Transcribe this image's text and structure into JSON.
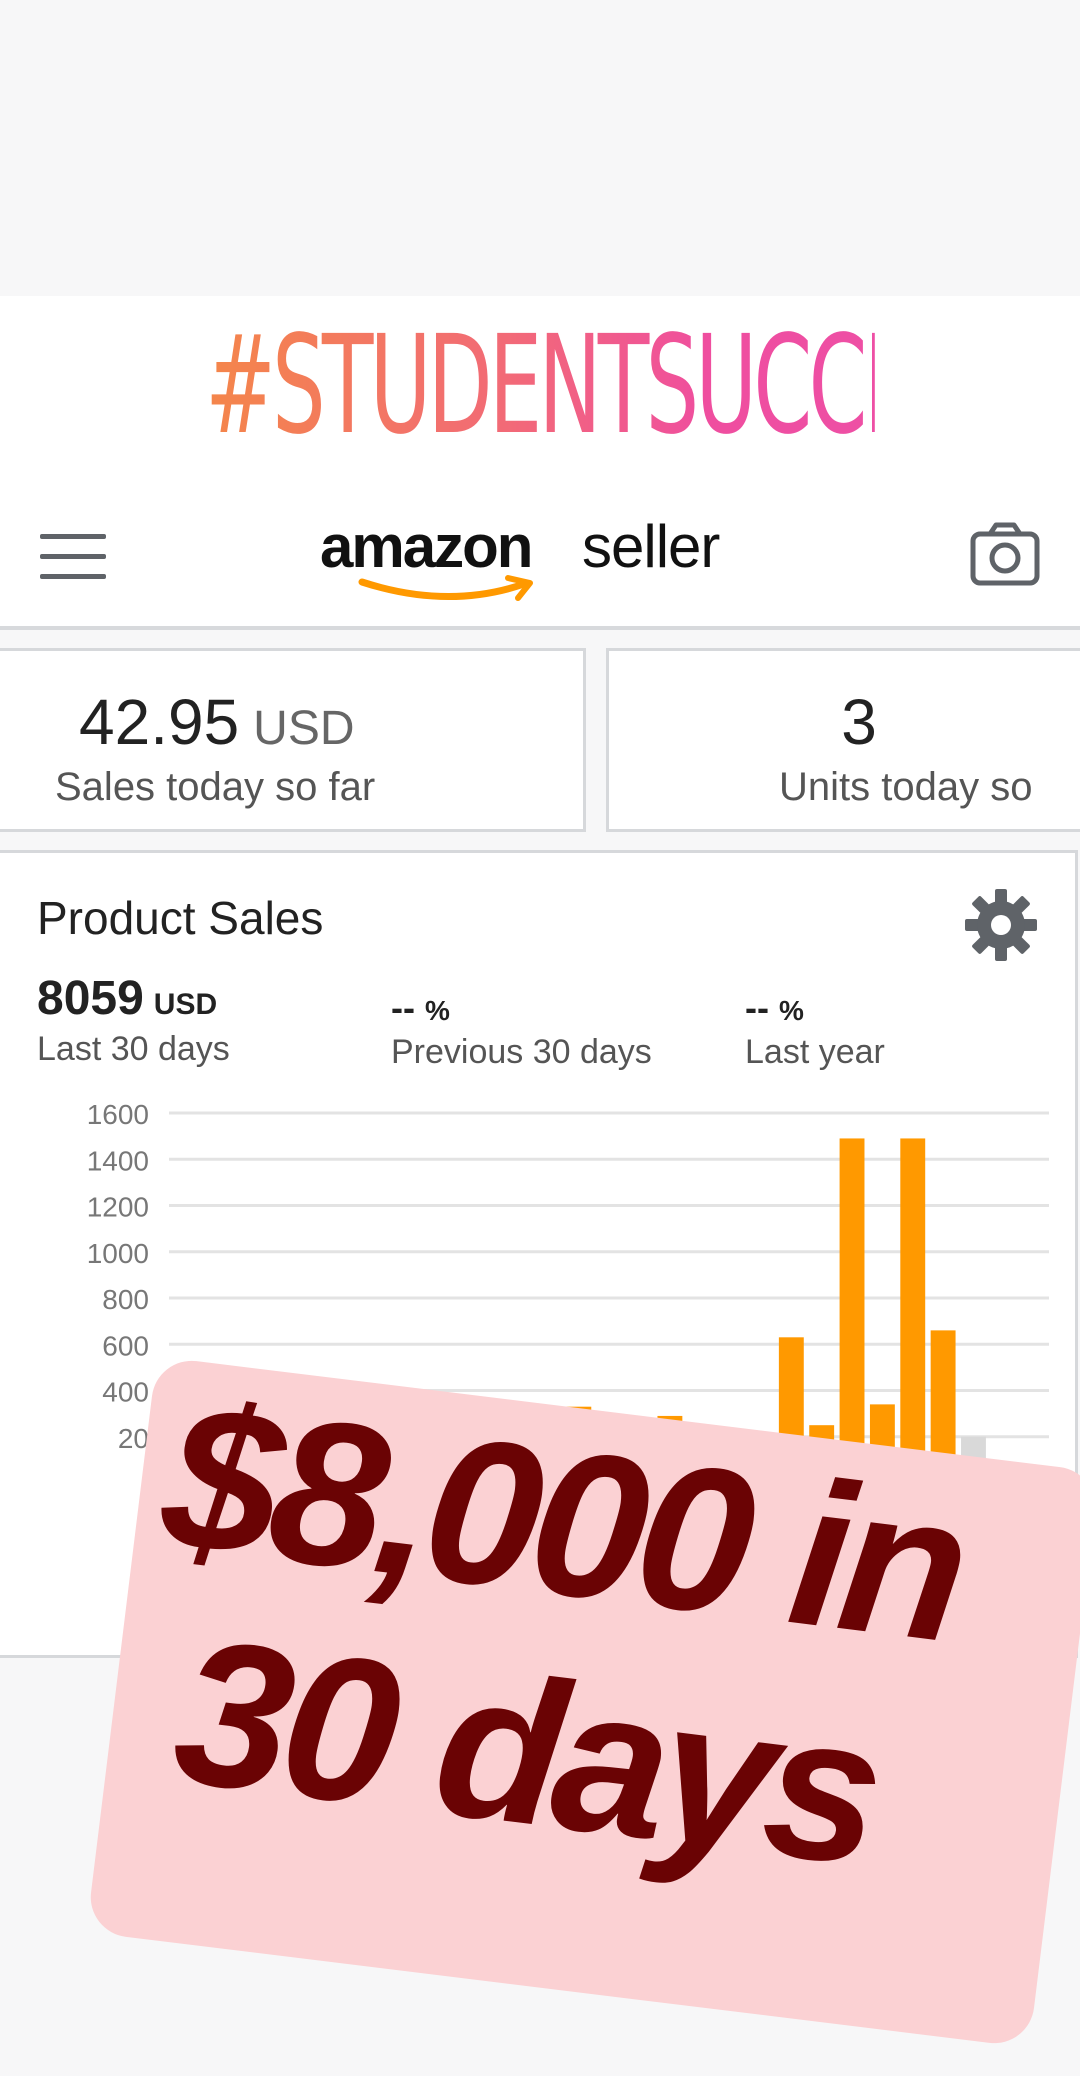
{
  "hashtag": "#STUDENTSUCCESS",
  "header": {
    "brand_main": "amazon",
    "brand_sub": "seller",
    "menu_icon": "hamburger-menu-icon",
    "camera_icon": "camera-icon"
  },
  "stats": [
    {
      "value": "42.95",
      "unit": "USD",
      "label": "Sales today so far"
    },
    {
      "value": "3",
      "unit": "",
      "label": "Units today so"
    }
  ],
  "product_sales": {
    "title": "Product Sales",
    "settings_icon": "gear-icon",
    "metrics": [
      {
        "value": "8059",
        "unit": "USD",
        "label": "Last 30 days"
      },
      {
        "value": "--",
        "unit": "%",
        "label": "Previous 30 days"
      },
      {
        "value": "--",
        "unit": "%",
        "label": "Last year"
      }
    ]
  },
  "chart_data": {
    "type": "bar",
    "y_ticks": [
      "1600",
      "1400",
      "1200",
      "1000",
      "800",
      "600",
      "400",
      "20"
    ],
    "ylim": [
      0,
      1600
    ],
    "bar_color": "#ff9900",
    "pending_color": "#d9d9d9",
    "grid": true,
    "values": [
      0,
      0,
      370,
      0,
      370,
      0,
      0,
      0,
      0,
      0,
      0,
      0,
      0,
      330,
      0,
      140,
      290,
      190,
      30,
      110,
      630,
      250,
      1490,
      340,
      1490,
      660,
      200,
      40
    ],
    "pending": [
      false,
      false,
      false,
      false,
      false,
      false,
      false,
      false,
      false,
      false,
      false,
      false,
      false,
      false,
      false,
      false,
      false,
      false,
      false,
      false,
      false,
      false,
      false,
      false,
      false,
      false,
      true,
      true
    ],
    "tick_label_right": "8"
  },
  "promo": {
    "line1": "$8,000 in",
    "line2": "30 days",
    "background": "#fbd1d3",
    "text_color": "#6a0304"
  },
  "colors": {
    "hashtag_start": "#f4864a",
    "hashtag_end": "#ee4fa5",
    "amazon_smile": "#ff9900"
  }
}
